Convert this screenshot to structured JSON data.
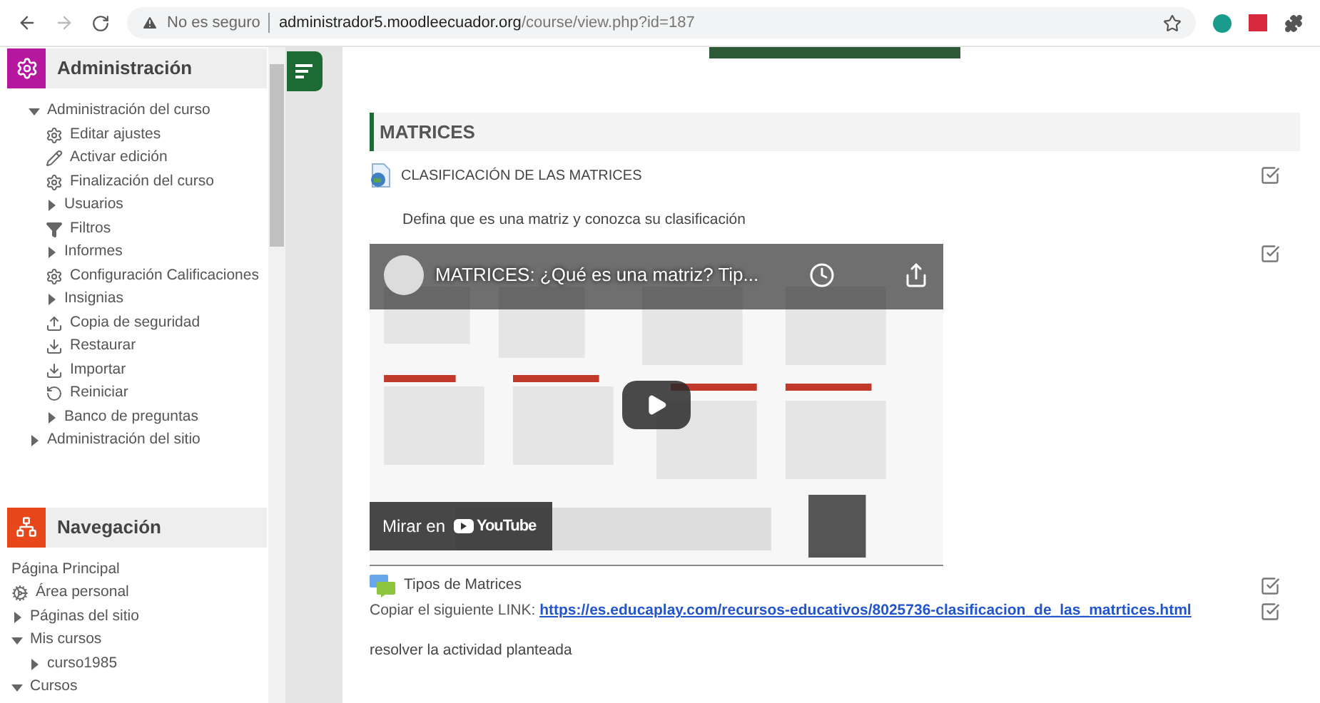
{
  "browser": {
    "security": "No es seguro",
    "url_host": "administrador5.moodleecuador.org",
    "url_path": "/course/view.php?id=187"
  },
  "admin_block": {
    "title": "Administración",
    "items": [
      {
        "label": "Administración del curso",
        "kind": "node",
        "expanded": true,
        "children": [
          {
            "label": "Editar ajustes",
            "kind": "gear"
          },
          {
            "label": "Activar edición",
            "kind": "pencil"
          },
          {
            "label": "Finalización del curso",
            "kind": "gear"
          },
          {
            "label": "Usuarios",
            "kind": "node",
            "expanded": false
          },
          {
            "label": "Filtros",
            "kind": "filter"
          },
          {
            "label": "Informes",
            "kind": "node",
            "expanded": false
          },
          {
            "label": "Configuración Calificaciones",
            "kind": "gear"
          },
          {
            "label": "Insignias",
            "kind": "node",
            "expanded": false
          },
          {
            "label": "Copia de seguridad",
            "kind": "upload"
          },
          {
            "label": "Restaurar",
            "kind": "download"
          },
          {
            "label": "Importar",
            "kind": "download"
          },
          {
            "label": "Reiniciar",
            "kind": "reset"
          },
          {
            "label": "Banco de preguntas",
            "kind": "node",
            "expanded": false
          }
        ]
      },
      {
        "label": "Administración del sitio",
        "kind": "node",
        "expanded": false
      }
    ]
  },
  "nav_block": {
    "title": "Navegación",
    "items": [
      {
        "label": "Página Principal",
        "kind": "plain"
      },
      {
        "label": "Área personal",
        "kind": "dashboard"
      },
      {
        "label": "Páginas del sitio",
        "kind": "node",
        "expanded": false
      },
      {
        "label": "Mis cursos",
        "kind": "node",
        "expanded": true,
        "children": [
          {
            "label": "curso1985",
            "kind": "node",
            "expanded": false
          }
        ]
      },
      {
        "label": "Cursos",
        "kind": "node",
        "expanded": true
      }
    ]
  },
  "section": {
    "title": "MATRICES",
    "activities": [
      {
        "kind": "url",
        "name": "CLASIFICACIÓN DE LAS MATRICES",
        "completed": true
      },
      {
        "kind": "text",
        "text": "Defina que es una matriz y conozca su clasificación"
      },
      {
        "kind": "video",
        "title": "MATRICES: ¿Qué es una matriz? Tip...",
        "watch_label": "Mirar en",
        "logo": "YouTube",
        "completed": true
      },
      {
        "kind": "forum",
        "name": "Tipos de Matrices",
        "completed": true
      },
      {
        "kind": "link",
        "prefix": "Copiar el siguiente LINK: ",
        "url": "https://es.educaplay.com/recursos-educativos/8025736-clasificacion_de_las_matrtices.html",
        "completed": true
      },
      {
        "kind": "text",
        "text": "resolver la actividad planteada"
      }
    ]
  }
}
